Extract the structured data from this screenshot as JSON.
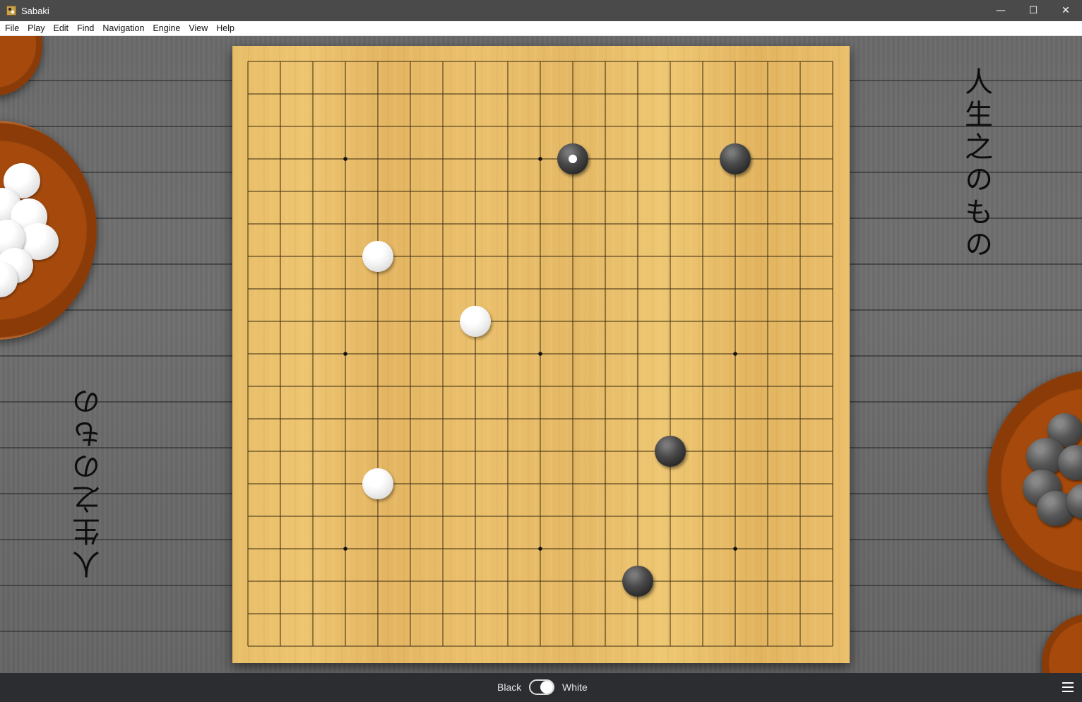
{
  "window": {
    "title": "Sabaki",
    "controls": {
      "minimize": "—",
      "maximize": "☐",
      "close": "✕"
    }
  },
  "menu": [
    "File",
    "Play",
    "Edit",
    "Find",
    "Navigation",
    "Engine",
    "View",
    "Help"
  ],
  "board": {
    "size": 19,
    "star_points": [
      [
        3,
        3
      ],
      [
        9,
        3
      ],
      [
        15,
        3
      ],
      [
        3,
        9
      ],
      [
        9,
        9
      ],
      [
        15,
        9
      ],
      [
        3,
        15
      ],
      [
        9,
        15
      ],
      [
        15,
        15
      ]
    ],
    "stones": [
      {
        "color": "black",
        "col": 10,
        "row": 3,
        "last_move": true
      },
      {
        "color": "black",
        "col": 15,
        "row": 3
      },
      {
        "color": "white",
        "col": 4,
        "row": 6
      },
      {
        "color": "white",
        "col": 7,
        "row": 8
      },
      {
        "color": "black",
        "col": 13,
        "row": 12
      },
      {
        "color": "white",
        "col": 4,
        "row": 13
      },
      {
        "color": "black",
        "col": 12,
        "row": 16
      }
    ]
  },
  "calligraphy": {
    "left": "人生之のもの",
    "right": "人生之のもの"
  },
  "players": {
    "black": "Black",
    "white": "White"
  },
  "colors": {
    "board": "#e8bd68",
    "table": "#6a6a6a",
    "bowl": "#a54a0c",
    "bottom_bar": "#2b2d30"
  }
}
